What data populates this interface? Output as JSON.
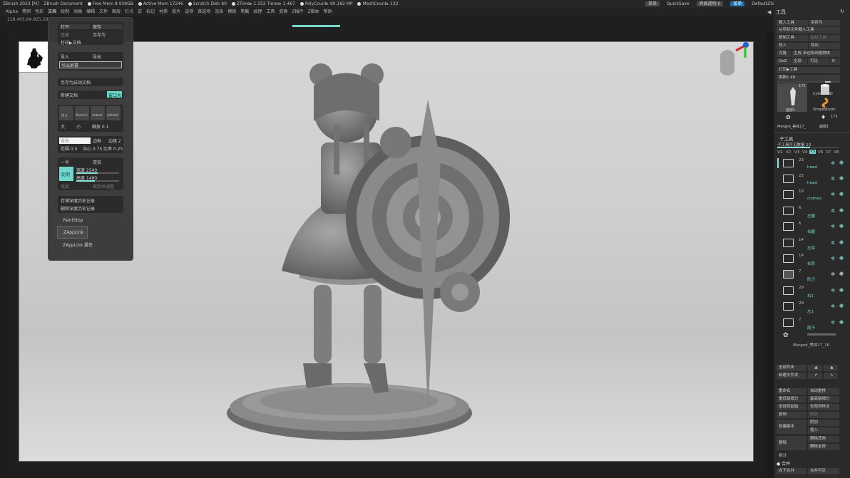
{
  "titlebar": {
    "app": "ZBrush 2023 [M]",
    "doc": "ZBrush Document",
    "free_mem": "Free Mem 8.939GB",
    "active_mem": "Active Mem 17246",
    "scratch": "Scratch Disk 80",
    "ztime": "ZTime▸ 1.252 Timer▸ 1.467",
    "polycount": "PolyCount▸ 90.182 MP",
    "meshcount": "MeshCount▸ 132"
  },
  "menubar": [
    "Alpha",
    "笔刷",
    "色彩",
    "文档",
    "绘制",
    "动画",
    "编辑",
    "文件",
    "图层",
    "灯光",
    "宏",
    "标记",
    "材质",
    "影片",
    "选项",
    "首选项",
    "渲染",
    "模板",
    "笔触",
    "纹理",
    "工具",
    "变换",
    "Z插件",
    "Z脚本",
    "帮助"
  ],
  "right_controls": {
    "lang": "菜单",
    "quicksave": "QuickSave",
    "transparency": "界面透明 0",
    "menu_btn": "菜单",
    "script": "DefaultZScript"
  },
  "coords": "118.405,64.925,28.596",
  "file_menu": {
    "open": "打开",
    "save": "保存",
    "revert": "还原",
    "save_as": "另存为",
    "print_doc": "打印▶文档",
    "import": "导入",
    "export": "导出",
    "export_screen": "导出屏幕",
    "save_startup": "另存为启动文档",
    "new_doc": "新建文档",
    "window_size": "窗口大小",
    "icons": [
      "尺寸",
      "Zoom½",
      "Actual",
      "AAHalf"
    ],
    "big": "大",
    "small": "小",
    "zoom": "缩放 0.1",
    "bg_label": "背景",
    "border": "边框",
    "border_val": "边缘 2",
    "range": "范围 0.5",
    "center": "中心 0.75",
    "ratio": "比率 0.25",
    "half": "一半",
    "double": "双倍",
    "proportion": "比例",
    "width": "宽度 2240",
    "height": "高度 1480",
    "w_btn": "宽度",
    "crop_btn": "裁剪并调整",
    "save_depth": "存储深度历史记录",
    "delete_depth": "删除深度历史记录",
    "paintstop": "PaintStop",
    "zapplink": "ZAppLink",
    "zapplink_props": "ZAppLink 属性"
  },
  "tool_panel": {
    "title": "工具",
    "load": "载入工具",
    "save_as": "另存为",
    "load_project": "从项目文件载入工具",
    "copy": "复制工具",
    "paste": "粘贴工具",
    "import": "导入",
    "export": "导出",
    "clone": "克隆",
    "make_polymesh": "生成 多边形网格物体",
    "goz": "GoZ",
    "all": "全部",
    "visible": "可见",
    "r": "R",
    "print_tool": "打印▶工具",
    "face_count": "面数€ 48",
    "thumbs": [
      {
        "name": "面部1",
        "count": "175"
      },
      {
        "name": "Cylinder3D",
        "count": ""
      },
      {
        "name": "SimpleBrush",
        "count": ""
      },
      {
        "name": "Merged_美体17_",
        "count": ""
      },
      {
        "name": "面部1",
        "count": "175"
      }
    ],
    "subtool_title": "子工具",
    "visible_count": "子工具可见数量 13",
    "vtabs": [
      "V1",
      "V2",
      "V3",
      "V4",
      "V5",
      "V6",
      "V7",
      "V8"
    ],
    "subtools": [
      {
        "num": "23",
        "name": "head"
      },
      {
        "num": "22",
        "name": "head"
      },
      {
        "num": "19",
        "name": "clothes"
      },
      {
        "num": "6",
        "name": "左腿"
      },
      {
        "num": "6",
        "name": "右腿"
      },
      {
        "num": "14",
        "name": "左臂"
      },
      {
        "num": "14",
        "name": "右臂"
      },
      {
        "num": "7",
        "name": "防卫"
      },
      {
        "num": "29",
        "name": "右1"
      },
      {
        "num": "29",
        "name": "左1"
      },
      {
        "num": "7",
        "name": "尾子"
      }
    ],
    "merged_label": "Merged_美体17_16",
    "list_all": "全部列出",
    "new_folder": "新建文件夹",
    "rename": "重命名",
    "auto_reorder": "自动重排",
    "all_low": "重低级细分",
    "all_high": "最高级细分",
    "all_to_all": "全部到起始",
    "all_to_end": "全部到终点",
    "duplicate": "复制",
    "append": "附加",
    "create_copy": "创建副本",
    "insert": "插入",
    "delete": "删除",
    "delete_others": "删除其他",
    "delete_all": "删除全部",
    "split": "拆分",
    "merge": "合并",
    "merge_down": "向下合并",
    "merge_visible": "合并可见"
  },
  "colors": {
    "accent": "#6fd6cc",
    "panel": "#2a2a2a",
    "menu_bg": "#373737"
  }
}
